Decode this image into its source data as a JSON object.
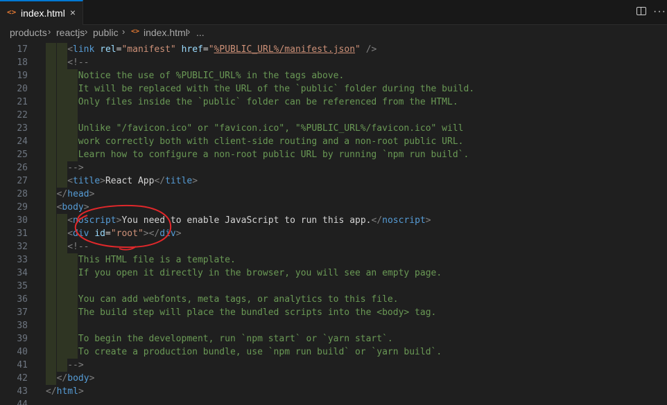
{
  "tab": {
    "icon": "<>",
    "icon_name": "html-file-icon",
    "label": "index.html",
    "close": "×"
  },
  "actions": {
    "split": "split-editor-icon",
    "more": "···"
  },
  "breadcrumb": {
    "items": [
      "products",
      "reactjs",
      "public"
    ],
    "file_icon": "<>",
    "file": "index.html",
    "ellipsis": "...",
    "separator": "›"
  },
  "colors": {
    "tag": "#569cd6",
    "attr": "#9cdcfe",
    "string": "#ce9178",
    "comment": "#6a9955",
    "annotation": "#e0282b"
  },
  "lines": [
    {
      "n": "17",
      "indent": 2,
      "tokens": [
        [
          "p",
          "<"
        ],
        [
          "tag",
          "link"
        ],
        [
          "txt",
          " "
        ],
        [
          "attr",
          "rel"
        ],
        [
          "txt",
          "="
        ],
        [
          "str",
          "\"manifest\""
        ],
        [
          "txt",
          " "
        ],
        [
          "attr",
          "href"
        ],
        [
          "txt",
          "="
        ],
        [
          "str",
          "\""
        ],
        [
          "strU",
          "%PUBLIC_URL%/manifest.json"
        ],
        [
          "str",
          "\""
        ],
        [
          "txt",
          " "
        ],
        [
          "p",
          "/>"
        ]
      ]
    },
    {
      "n": "18",
      "indent": 2,
      "tokens": [
        [
          "p",
          "<!--"
        ]
      ]
    },
    {
      "n": "19",
      "indent": 3,
      "tokens": [
        [
          "cm",
          "Notice the use of %PUBLIC_URL% in the tags above."
        ]
      ]
    },
    {
      "n": "20",
      "indent": 3,
      "tokens": [
        [
          "cm",
          "It will be replaced with the URL of the `public` folder during the build."
        ]
      ]
    },
    {
      "n": "21",
      "indent": 3,
      "tokens": [
        [
          "cm",
          "Only files inside the `public` folder can be referenced from the HTML."
        ]
      ]
    },
    {
      "n": "22",
      "indent": 3,
      "tokens": []
    },
    {
      "n": "23",
      "indent": 3,
      "tokens": [
        [
          "cm",
          "Unlike \"/favicon.ico\" or \"favicon.ico\", \"%PUBLIC_URL%/favicon.ico\" will"
        ]
      ]
    },
    {
      "n": "24",
      "indent": 3,
      "tokens": [
        [
          "cm",
          "work correctly both with client-side routing and a non-root public URL."
        ]
      ]
    },
    {
      "n": "25",
      "indent": 3,
      "tokens": [
        [
          "cm",
          "Learn how to configure a non-root public URL by running `npm run build`."
        ]
      ]
    },
    {
      "n": "26",
      "indent": 2,
      "tokens": [
        [
          "p",
          "-->"
        ]
      ]
    },
    {
      "n": "27",
      "indent": 2,
      "tokens": [
        [
          "p",
          "<"
        ],
        [
          "tag",
          "title"
        ],
        [
          "p",
          ">"
        ],
        [
          "txt",
          "React App"
        ],
        [
          "p",
          "</"
        ],
        [
          "tag",
          "title"
        ],
        [
          "p",
          ">"
        ]
      ]
    },
    {
      "n": "28",
      "indent": 1,
      "tokens": [
        [
          "p",
          "</"
        ],
        [
          "tag",
          "head"
        ],
        [
          "p",
          ">"
        ]
      ]
    },
    {
      "n": "29",
      "indent": 1,
      "tokens": [
        [
          "p",
          "<"
        ],
        [
          "tag",
          "body"
        ],
        [
          "p",
          ">"
        ]
      ]
    },
    {
      "n": "30",
      "indent": 2,
      "tokens": [
        [
          "p",
          "<"
        ],
        [
          "tag",
          "noscript"
        ],
        [
          "p",
          ">"
        ],
        [
          "txt",
          "You need to enable JavaScript to run this app."
        ],
        [
          "p",
          "</"
        ],
        [
          "tag",
          "noscript"
        ],
        [
          "p",
          ">"
        ]
      ]
    },
    {
      "n": "31",
      "indent": 2,
      "tokens": [
        [
          "p",
          "<"
        ],
        [
          "tag",
          "div"
        ],
        [
          "txt",
          " "
        ],
        [
          "attr",
          "id"
        ],
        [
          "txt",
          "="
        ],
        [
          "str",
          "\"root\""
        ],
        [
          "p",
          "></"
        ],
        [
          "tag",
          "div"
        ],
        [
          "p",
          ">"
        ]
      ]
    },
    {
      "n": "32",
      "indent": 2,
      "tokens": [
        [
          "p",
          "<!--"
        ]
      ]
    },
    {
      "n": "33",
      "indent": 3,
      "tokens": [
        [
          "cm",
          "This HTML file is a template."
        ]
      ]
    },
    {
      "n": "34",
      "indent": 3,
      "tokens": [
        [
          "cm",
          "If you open it directly in the browser, you will see an empty page."
        ]
      ]
    },
    {
      "n": "35",
      "indent": 3,
      "tokens": []
    },
    {
      "n": "36",
      "indent": 3,
      "tokens": [
        [
          "cm",
          "You can add webfonts, meta tags, or analytics to this file."
        ]
      ]
    },
    {
      "n": "37",
      "indent": 3,
      "tokens": [
        [
          "cm",
          "The build step will place the bundled scripts into the <body> tag."
        ]
      ]
    },
    {
      "n": "38",
      "indent": 3,
      "tokens": []
    },
    {
      "n": "39",
      "indent": 3,
      "tokens": [
        [
          "cm",
          "To begin the development, run `npm start` or `yarn start`."
        ]
      ]
    },
    {
      "n": "40",
      "indent": 3,
      "tokens": [
        [
          "cm",
          "To create a production bundle, use `npm run build` or `yarn build`."
        ]
      ]
    },
    {
      "n": "41",
      "indent": 2,
      "tokens": [
        [
          "p",
          "-->"
        ]
      ]
    },
    {
      "n": "42",
      "indent": 1,
      "tokens": [
        [
          "p",
          "</"
        ],
        [
          "tag",
          "body"
        ],
        [
          "p",
          ">"
        ]
      ]
    },
    {
      "n": "43",
      "indent": 0,
      "tokens": [
        [
          "p",
          "</"
        ],
        [
          "tag",
          "html"
        ],
        [
          "p",
          ">"
        ]
      ]
    },
    {
      "n": "44",
      "indent": 0,
      "tokens": []
    }
  ]
}
